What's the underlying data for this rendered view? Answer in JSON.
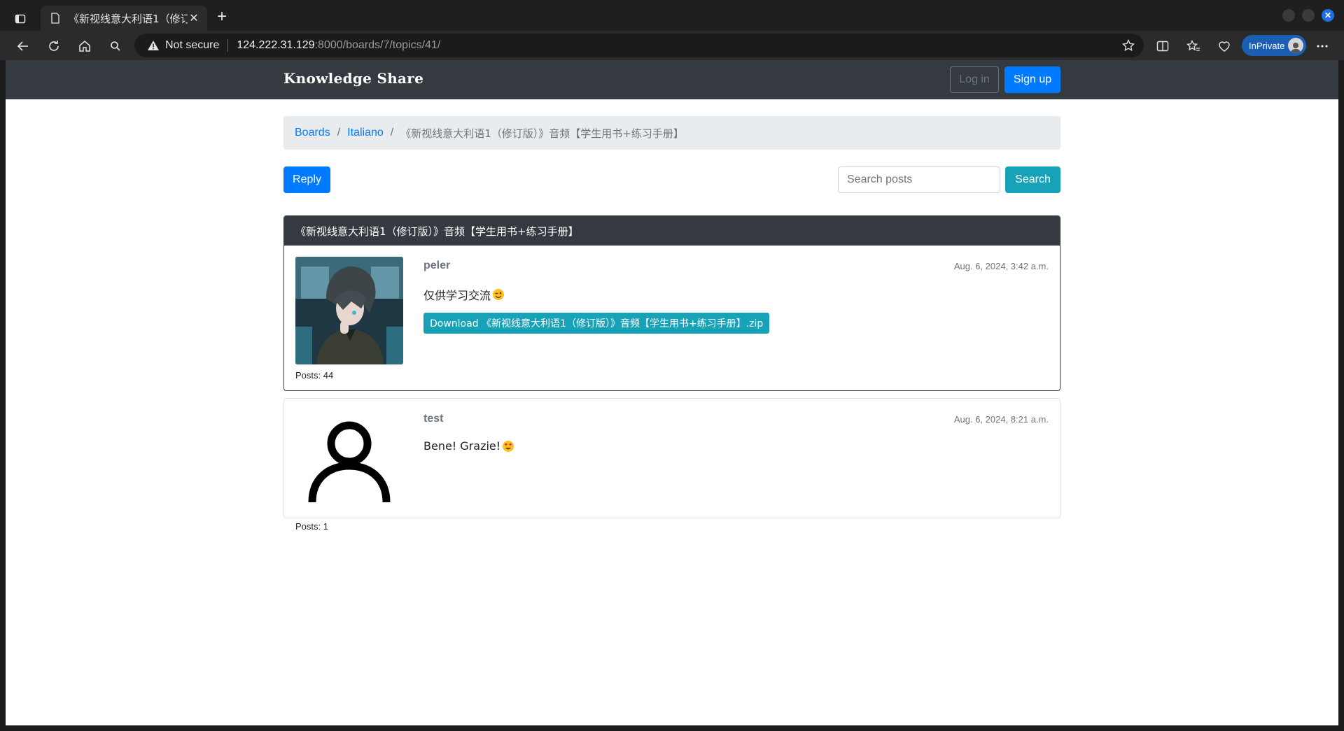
{
  "browser": {
    "tab_title": "《新视线意大利语1（修订",
    "not_secure": "Not secure",
    "url_host": "124.222.31.129",
    "url_rest": ":8000/boards/7/topics/41/",
    "inprivate_label": "InPrivate"
  },
  "navbar": {
    "brand": "Knowledge Share",
    "login": "Log in",
    "signup": "Sign up"
  },
  "breadcrumb": {
    "boards": "Boards",
    "board": "Italiano",
    "topic": "《新视线意大利语1（修订版）》音频【学生用书+练习手册】"
  },
  "actions": {
    "reply": "Reply",
    "search_placeholder": "Search posts",
    "search": "Search"
  },
  "topic": {
    "header": "《新视线意大利语1（修订版）》音频【学生用书+练习手册】"
  },
  "posts": [
    {
      "username": "peler",
      "date": "Aug. 6, 2024, 3:42 a.m.",
      "message": "仅供学习交流",
      "emoji": "winking-face",
      "download": "Download 《新视线意大利语1（修订版）》音频【学生用书+练习手册】.zip",
      "posts_count": "Posts: 44"
    },
    {
      "username": "test",
      "date": "Aug. 6, 2024, 8:21 a.m.",
      "message": "Bene! Grazie!",
      "emoji": "heart-eyes-face",
      "posts_count": "Posts: 1"
    }
  ],
  "colors": {
    "primary": "#007bff",
    "info": "#17a2b8",
    "dark": "#343a40",
    "breadcrumb_bg": "#e9ecef"
  }
}
